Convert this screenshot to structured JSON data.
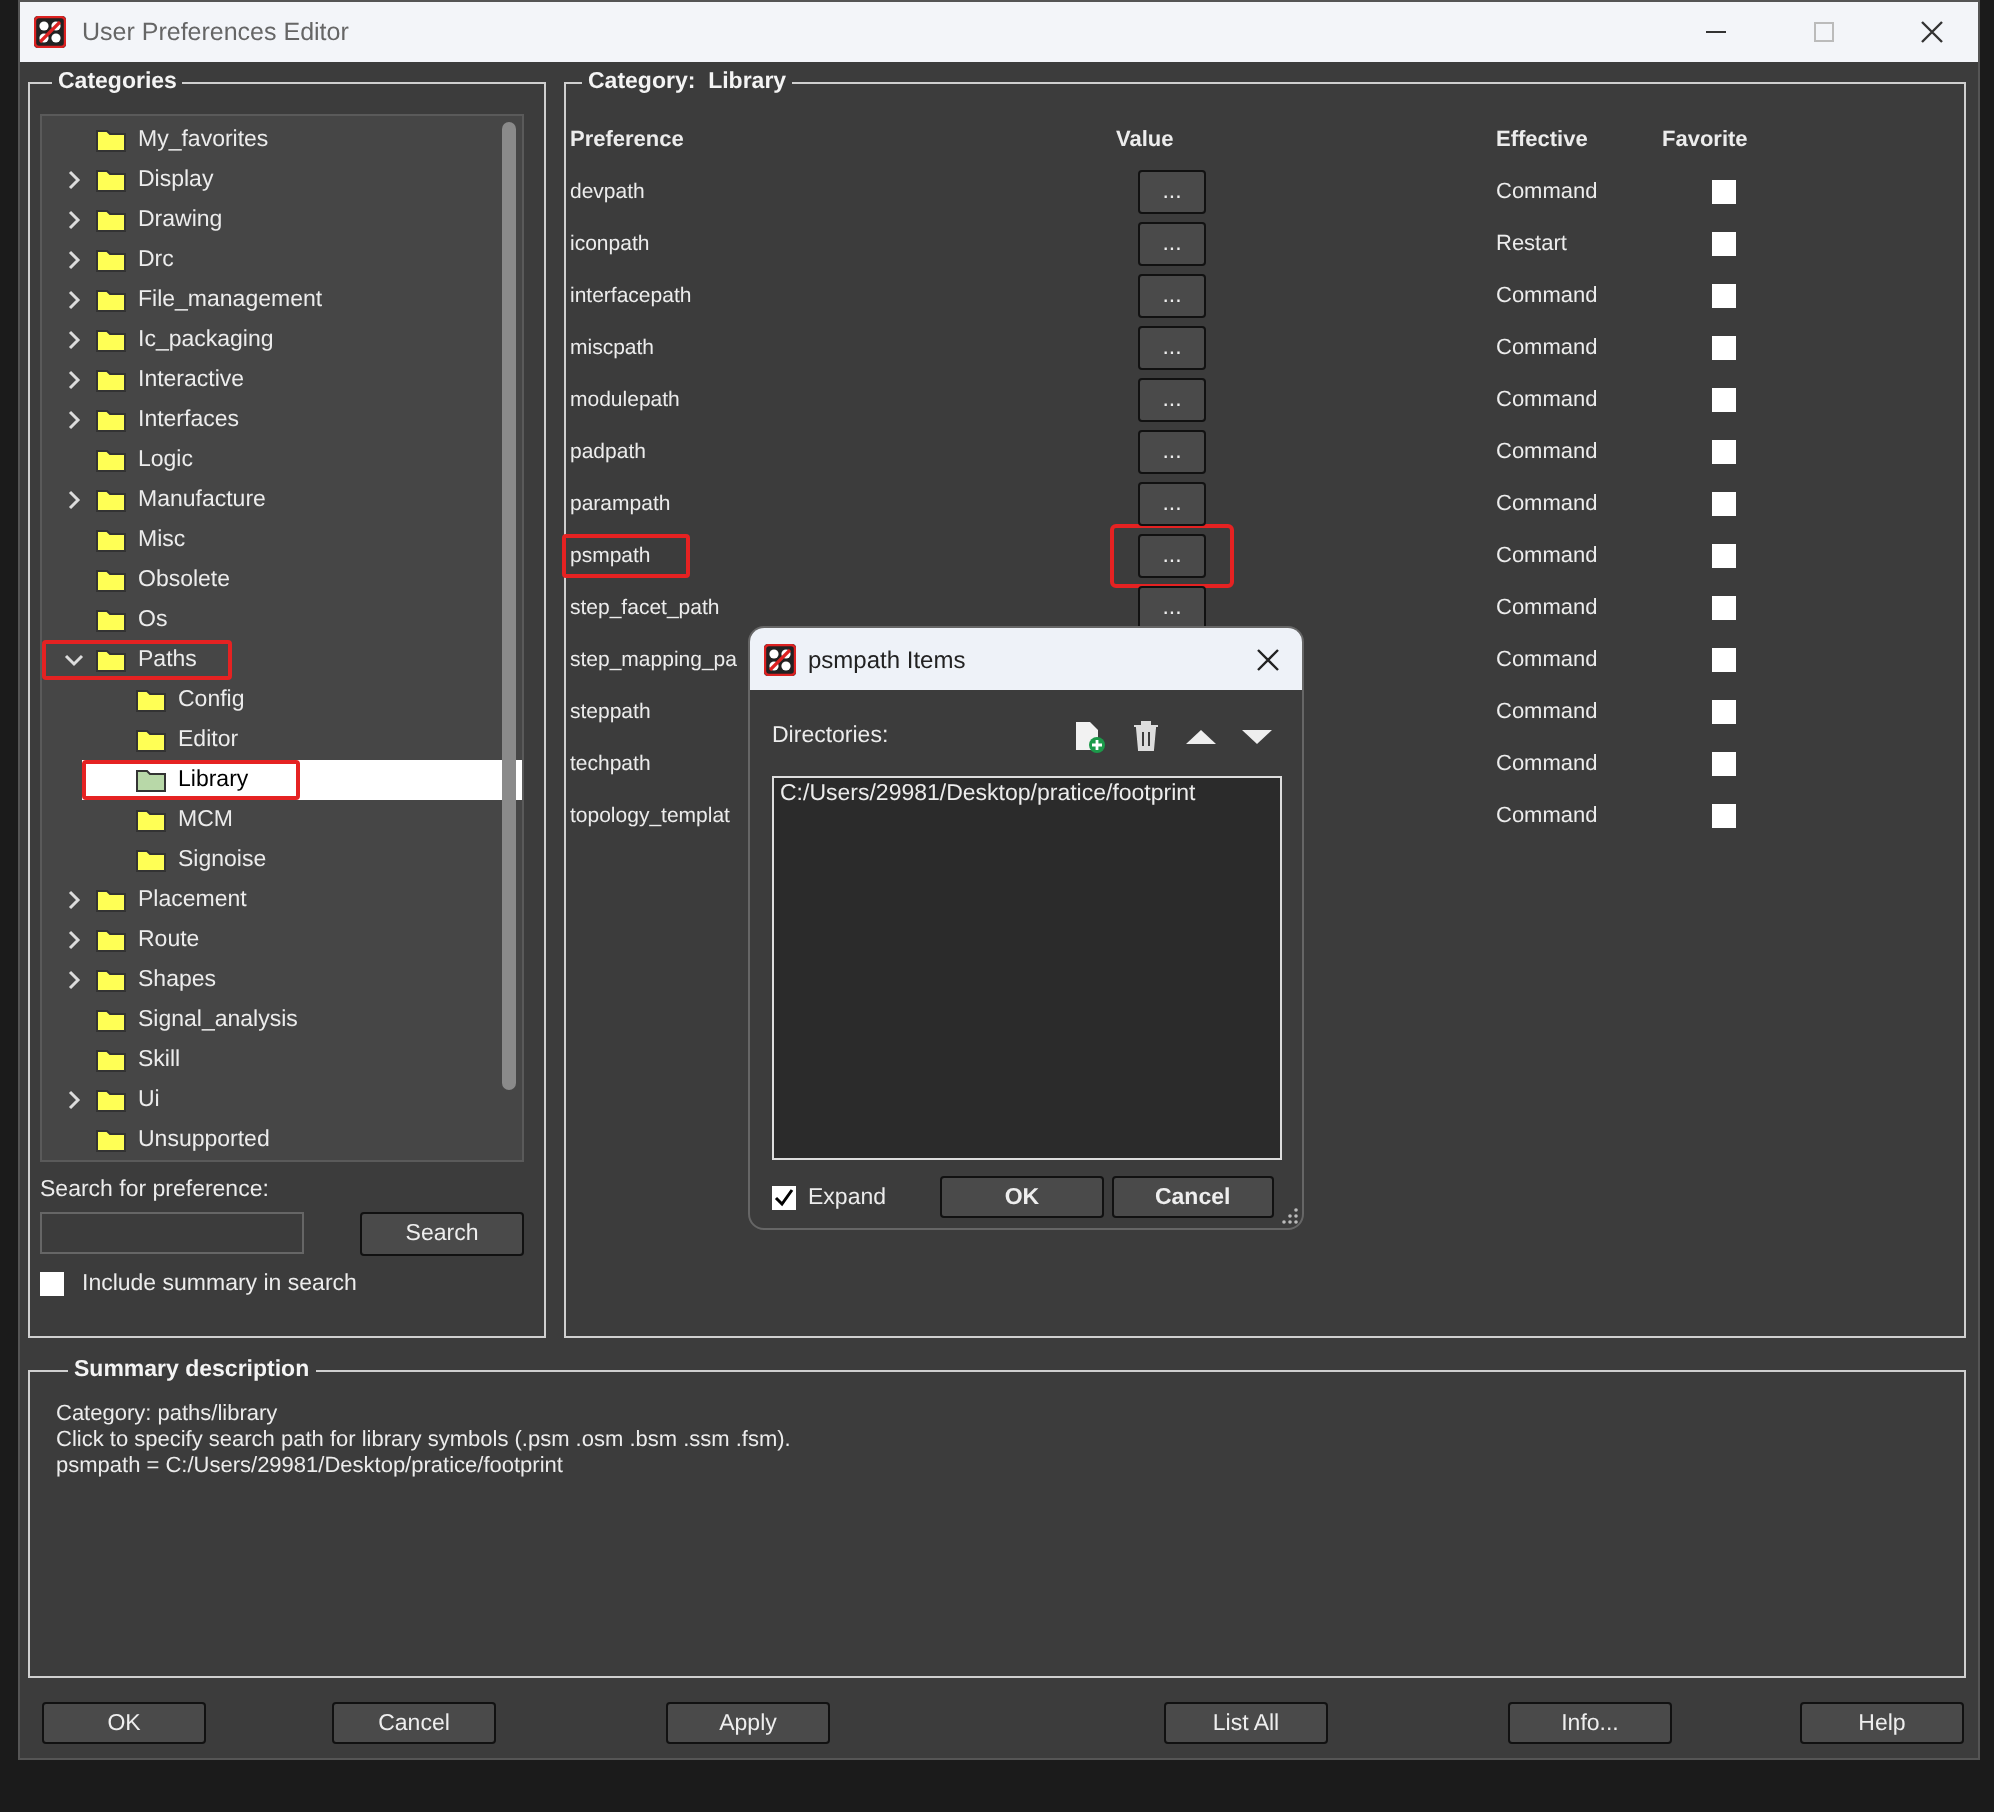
{
  "window": {
    "title": "User Preferences Editor"
  },
  "categories": {
    "title": "Categories",
    "tree": [
      {
        "label": "My_favorites",
        "selected": false,
        "highlighted": false
      },
      {
        "label": "Display",
        "expanded": false,
        "selected": false,
        "highlighted": false
      },
      {
        "label": "Drawing",
        "expanded": false,
        "selected": false,
        "highlighted": false
      },
      {
        "label": "Drc",
        "expanded": false,
        "selected": false,
        "highlighted": false
      },
      {
        "label": "File_management",
        "expanded": false,
        "selected": false,
        "highlighted": false
      },
      {
        "label": "Ic_packaging",
        "expanded": false,
        "selected": false,
        "highlighted": false
      },
      {
        "label": "Interactive",
        "expanded": false,
        "selected": false,
        "highlighted": false
      },
      {
        "label": "Interfaces",
        "expanded": false,
        "selected": false,
        "highlighted": false
      },
      {
        "label": "Logic",
        "selected": false,
        "highlighted": false
      },
      {
        "label": "Manufacture",
        "expanded": false,
        "selected": false,
        "highlighted": false
      },
      {
        "label": "Misc",
        "selected": false,
        "highlighted": false
      },
      {
        "label": "Obsolete",
        "selected": false,
        "highlighted": false
      },
      {
        "label": "Os",
        "selected": false,
        "highlighted": false
      },
      {
        "label": "Paths",
        "expanded": true,
        "selected": false,
        "highlighted": true,
        "children": [
          {
            "label": "Config",
            "selected": false,
            "highlighted": false
          },
          {
            "label": "Editor",
            "selected": false,
            "highlighted": false
          },
          {
            "label": "Library",
            "selected": true,
            "highlighted": true
          },
          {
            "label": "MCM",
            "selected": false,
            "highlighted": false
          },
          {
            "label": "Signoise",
            "selected": false,
            "highlighted": false
          }
        ]
      },
      {
        "label": "Placement",
        "expanded": false,
        "selected": false,
        "highlighted": false
      },
      {
        "label": "Route",
        "expanded": false,
        "selected": false,
        "highlighted": false
      },
      {
        "label": "Shapes",
        "expanded": false,
        "selected": false,
        "highlighted": false
      },
      {
        "label": "Signal_analysis",
        "selected": false,
        "highlighted": false
      },
      {
        "label": "Skill",
        "selected": false,
        "highlighted": false
      },
      {
        "label": "Ui",
        "expanded": false,
        "selected": false,
        "highlighted": false
      },
      {
        "label": "Unsupported",
        "selected": false,
        "highlighted": false
      }
    ],
    "search_label": "Search for preference:",
    "search_button": "Search",
    "include_summary": {
      "label": "Include summary in search",
      "checked": false
    }
  },
  "category": {
    "label": "Category:",
    "name": "Library",
    "columns": [
      "Preference",
      "Value",
      "Effective",
      "Favorite"
    ],
    "rows": [
      {
        "preference": "devpath",
        "value": "...",
        "effective": "Command",
        "favorite": false,
        "highlighted": false
      },
      {
        "preference": "iconpath",
        "value": "...",
        "effective": "Restart",
        "favorite": false,
        "highlighted": false
      },
      {
        "preference": "interfacepath",
        "value": "...",
        "effective": "Command",
        "favorite": false,
        "highlighted": false
      },
      {
        "preference": "miscpath",
        "value": "...",
        "effective": "Command",
        "favorite": false,
        "highlighted": false
      },
      {
        "preference": "modulepath",
        "value": "...",
        "effective": "Command",
        "favorite": false,
        "highlighted": false
      },
      {
        "preference": "padpath",
        "value": "...",
        "effective": "Command",
        "favorite": false,
        "highlighted": false
      },
      {
        "preference": "parampath",
        "value": "...",
        "effective": "Command",
        "favorite": false,
        "highlighted": false
      },
      {
        "preference": "psmpath",
        "value": "...",
        "effective": "Command",
        "favorite": false,
        "highlighted": true
      },
      {
        "preference": "step_facet_path",
        "value": "...",
        "effective": "Command",
        "favorite": false,
        "highlighted": false
      },
      {
        "preference": "step_mapping_pa",
        "effective": "Command",
        "favorite": false,
        "highlighted": false
      },
      {
        "preference": "steppath",
        "effective": "Command",
        "favorite": false,
        "highlighted": false
      },
      {
        "preference": "techpath",
        "effective": "Command",
        "favorite": false,
        "highlighted": false
      },
      {
        "preference": "topology_templat",
        "effective": "Command",
        "favorite": false,
        "highlighted": false
      }
    ]
  },
  "summary": {
    "title": "Summary description",
    "lines": [
      "Category: paths/library",
      "Click to specify search path for library symbols (.psm .osm .bsm .ssm .fsm).",
      "psmpath = C:/Users/29981/Desktop/pratice/footprint"
    ]
  },
  "buttons": [
    "OK",
    "Cancel",
    "Apply",
    "List All",
    "Info...",
    "Help"
  ],
  "dialog": {
    "title": "psmpath Items",
    "label": "Directories:",
    "items": [
      "C:/Users/29981/Desktop/pratice/footprint"
    ],
    "expand": {
      "label": "Expand",
      "checked": true
    },
    "buttons": [
      "OK",
      "Cancel"
    ]
  }
}
